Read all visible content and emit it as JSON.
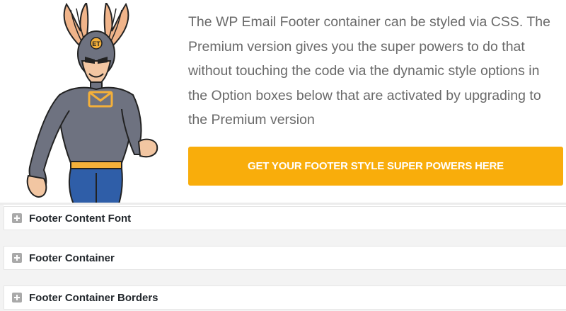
{
  "promo": {
    "description": "The WP Email Footer container can be styled via CSS. The Premium version gives you the super powers to do that without touching the code via the dynamic style options in the Option boxes below that are activated by upgrading to the Premium version",
    "button_label": "GET YOUR FOOTER STYLE SUPER POWERS HERE",
    "button_color": "#f9ad0b",
    "hero_badge_text": "ET"
  },
  "option_boxes": [
    {
      "title": "Footer Content Font",
      "icon": "plus-square-icon"
    },
    {
      "title": "Footer Container",
      "icon": "plus-square-icon"
    },
    {
      "title": "Footer Container Borders",
      "icon": "plus-square-icon"
    }
  ]
}
